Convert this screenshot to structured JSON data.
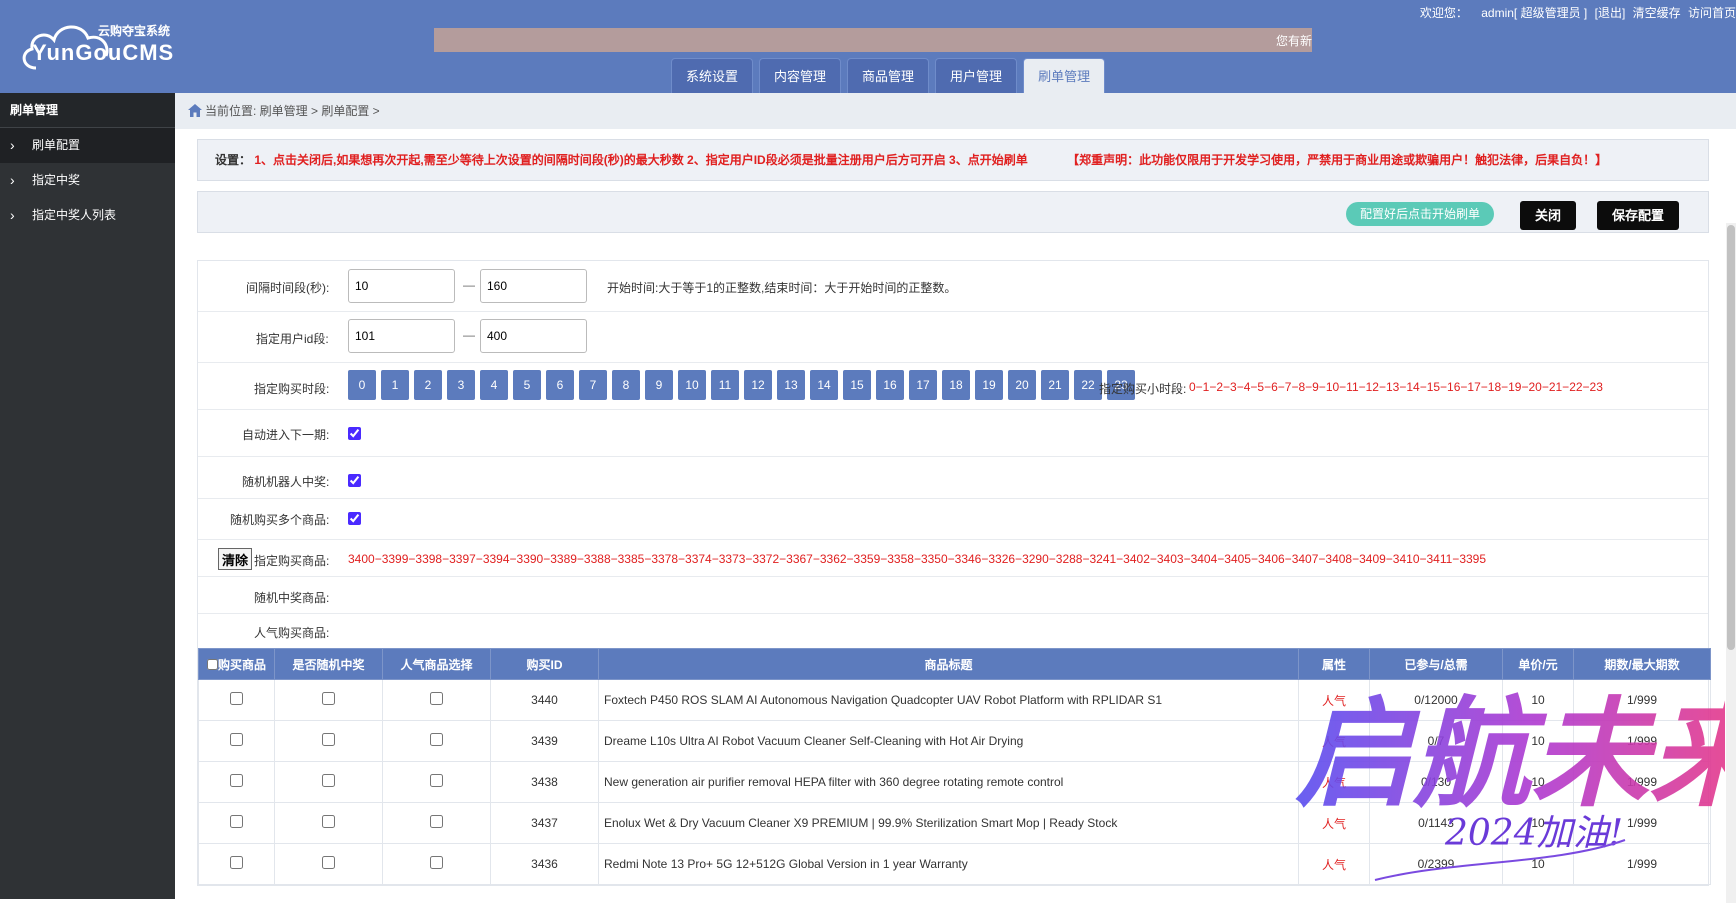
{
  "header": {
    "logo_cn": "云购夺宝系统",
    "logo_en": "YunGouCMS",
    "marquee": "您有新",
    "welcome": "欢迎您：",
    "user": "admin[ 超级管理员 ]",
    "logout": "[退出]",
    "clear_cache": "清空缓存",
    "visit_home": "访问首页"
  },
  "tabs": [
    {
      "label": "系统设置"
    },
    {
      "label": "内容管理"
    },
    {
      "label": "商品管理"
    },
    {
      "label": "用户管理"
    },
    {
      "label": "刷单管理"
    }
  ],
  "sidebar": {
    "title": "刷单管理",
    "items": [
      {
        "label": "刷单配置"
      },
      {
        "label": "指定中奖"
      },
      {
        "label": "指定中奖人列表"
      }
    ]
  },
  "breadcrumb": "当前位置: 刷单管理 > 刷单配置 >",
  "notice": {
    "label": "设置：",
    "text": "1、点击关闭后,如果想再次开起,需至少等待上次设置的间隔时间段(秒)的最大秒数 2、指定用户ID段必须是批量注册用户后方可开启 3、点开始刷单",
    "warning": "【郑重声明：此功能仅限用于开发学习使用，严禁用于商业用途或欺骗用户！触犯法律，后果自负！】"
  },
  "actions": {
    "start_hint": "配置好后点击开始刷单",
    "close": "关闭",
    "save": "保存配置"
  },
  "form": {
    "interval_label": "间隔时间段(秒):",
    "interval_from": "10",
    "interval_to": "160",
    "interval_hint": "开始时间:大于等于1的正整数,结束时间：大于开始时间的正整数。",
    "userid_label": "指定用户id段:",
    "userid_from": "101",
    "userid_to": "400",
    "dash": "—",
    "hours_label": "指定购买时段:",
    "hours": [
      "0",
      "1",
      "2",
      "3",
      "4",
      "5",
      "6",
      "7",
      "8",
      "9",
      "10",
      "11",
      "12",
      "13",
      "14",
      "15",
      "16",
      "17",
      "18",
      "19",
      "20",
      "21",
      "22",
      "23"
    ],
    "hours_selected_label": "指定购买小时段:",
    "hours_selected": "0−1−2−3−4−5−6−7−8−9−10−11−12−13−14−15−16−17−18−19−20−21−22−23",
    "auto_next_label": "自动进入下一期:",
    "robot_win_label": "随机机器人中奖:",
    "multi_buy_label": "随机购买多个商品:",
    "clear_btn": "清除",
    "goods_label": "指定购买商品:",
    "goods_ids": "3400−3399−3398−3397−3394−3390−3389−3388−3385−3378−3374−3373−3372−3367−3362−3359−3358−3350−3346−3326−3290−3288−3241−3402−3403−3404−3405−3406−3407−3408−3409−3410−3411−3395",
    "random_win_label": "随机中奖商品:",
    "hot_goods_label": "人气购买商品:"
  },
  "table": {
    "headers": [
      "购买商品",
      "是否随机中奖",
      "人气商品选择",
      "购买ID",
      "商品标题",
      "属性",
      "已参与/总需",
      "单价/元",
      "期数/最大期数"
    ],
    "rows": [
      {
        "id": "3440",
        "title": "Foxtech P450 ROS SLAM AI Autonomous Navigation Quadcopter UAV Robot Platform with RPLIDAR S1",
        "attr": "人气",
        "progress": "0/12000",
        "price": "10",
        "period": "1/999"
      },
      {
        "id": "3439",
        "title": "Dreame L10s Ultra AI Robot Vacuum Cleaner Self-Cleaning with Hot Air Drying",
        "attr": "人气",
        "progress": "0/7",
        "price": "10",
        "period": "1/999"
      },
      {
        "id": "3438",
        "title": "New generation air purifier removal HEPA filter with 360 degree rotating remote control",
        "attr": "人气",
        "progress": "0/130",
        "price": "10",
        "period": "1/999"
      },
      {
        "id": "3437",
        "title": "Enolux Wet & Dry Vacuum Cleaner X9 PREMIUM | 99.9% Sterilization Smart Mop | Ready Stock",
        "attr": "人气",
        "progress": "0/1143",
        "price": "10",
        "period": "1/999"
      },
      {
        "id": "3436",
        "title": "Redmi Note 13 Pro+ 5G 12+512G Global Version in 1 year Warranty",
        "attr": "人气",
        "progress": "0/2399",
        "price": "10",
        "period": "1/999"
      }
    ]
  },
  "watermark": {
    "main": "启航未来",
    "sub": "2024加油!"
  },
  "colors": {
    "header_bg": "#5c7bbd",
    "sidebar_bg": "#2f3235",
    "accent_green": "#5bcab7",
    "warning_red": "#e02020"
  }
}
